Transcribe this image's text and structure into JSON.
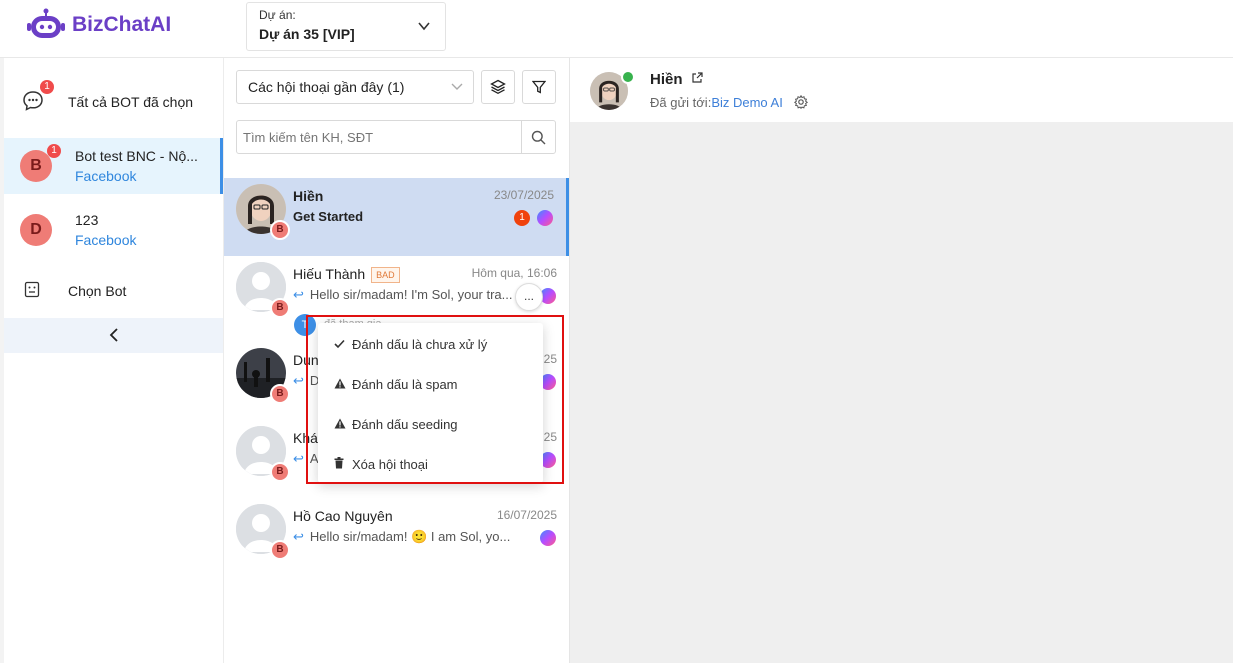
{
  "app": {
    "brand_part1": "Biz",
    "brand_part2": "ChatAI"
  },
  "project": {
    "label": "Dự án:",
    "value": "Dự án 35 [VIP]"
  },
  "sidebar": {
    "all_bots": {
      "label": "Tất cả BOT đã chọn",
      "badge": "1"
    },
    "bots": [
      {
        "letter": "B",
        "name": "Bot test BNC - Nộ...",
        "platform": "Facebook",
        "badge": "1"
      },
      {
        "letter": "D",
        "name": "123",
        "platform": "Facebook"
      }
    ],
    "choose_bot": "Chọn Bot"
  },
  "conversations_panel": {
    "filter": "Các hội thoại gần đây (1)",
    "search_placeholder": "Tìm kiếm tên KH, SĐT",
    "items": [
      {
        "name": "Hiền",
        "time": "23/07/2025",
        "message": "Get Started",
        "unread": "1",
        "bot": "B"
      },
      {
        "name": "Hiếu Thành",
        "tag": "BAD",
        "time": "Hôm qua, 16:06",
        "message": "Hello sir/madam! I'm Sol, your tra...",
        "bot": "B",
        "assignee": "T",
        "assignee_text": "đã tham gia"
      },
      {
        "name": "Dun",
        "time": "25",
        "message": "D",
        "bot": "B"
      },
      {
        "name": "Khá",
        "time": "25",
        "message": "A",
        "bot": "B"
      },
      {
        "name": "Hồ Cao Nguyên",
        "time": "16/07/2025",
        "message": "Hello sir/madam! 🙂 I am Sol, yo...",
        "bot": "B"
      }
    ],
    "more_label": "..."
  },
  "context_menu": {
    "items": [
      {
        "icon": "check-icon",
        "label": "Đánh dấu là chưa xử lý"
      },
      {
        "icon": "warning-icon",
        "label": "Đánh dấu là spam"
      },
      {
        "icon": "warning-icon",
        "label": "Đánh dấu seeding"
      },
      {
        "icon": "trash-icon",
        "label": "Xóa hội thoại"
      }
    ]
  },
  "chat_header": {
    "name": "Hiền",
    "sent_prefix": "Đã gửi tới:",
    "sent_to": "Biz Demo AI"
  },
  "colors": {
    "accent": "#3d8fe6",
    "brand": "#6b3fc6",
    "danger": "#e01010",
    "bot_avatar": "#ef7c76"
  }
}
